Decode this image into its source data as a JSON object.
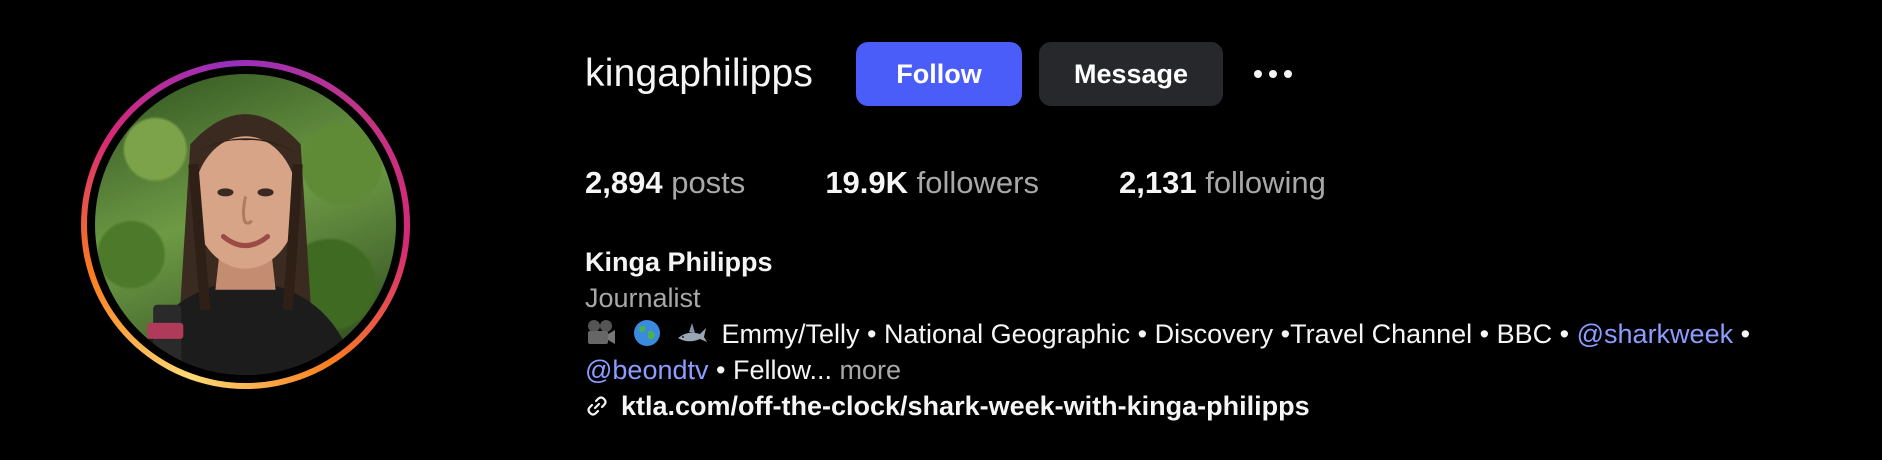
{
  "profile": {
    "username": "kingaphilipps",
    "avatar_alt": "Kinga Philipps profile picture"
  },
  "actions": {
    "follow_label": "Follow",
    "message_label": "Message",
    "more_icon": "more-options-icon"
  },
  "stats": {
    "posts": {
      "count": "2,894",
      "label": "posts"
    },
    "followers": {
      "count": "19.9K",
      "label": "followers"
    },
    "following": {
      "count": "2,131",
      "label": "following"
    }
  },
  "bio": {
    "full_name": "Kinga Philipps",
    "category": "Journalist",
    "emojis": [
      "movie-camera-icon",
      "globe-icon",
      "shark-icon"
    ],
    "line1_text": "Emmy/Telly • National Geographic • Discovery •Travel Channel • BBC •",
    "mention1": "@sharkweek",
    "line1_tail": "•",
    "mention2": "@beondtv",
    "line2_text": "• Fellow...",
    "more_label": "more",
    "link_icon": "link-icon",
    "link_text": "ktla.com/off-the-clock/shark-week-with-kinga-philipps"
  },
  "colors": {
    "background": "#000000",
    "follow_button": "#4a5df9",
    "message_button": "#26282c",
    "mention": "#8c9cff",
    "muted_text": "#a8a8a8"
  }
}
